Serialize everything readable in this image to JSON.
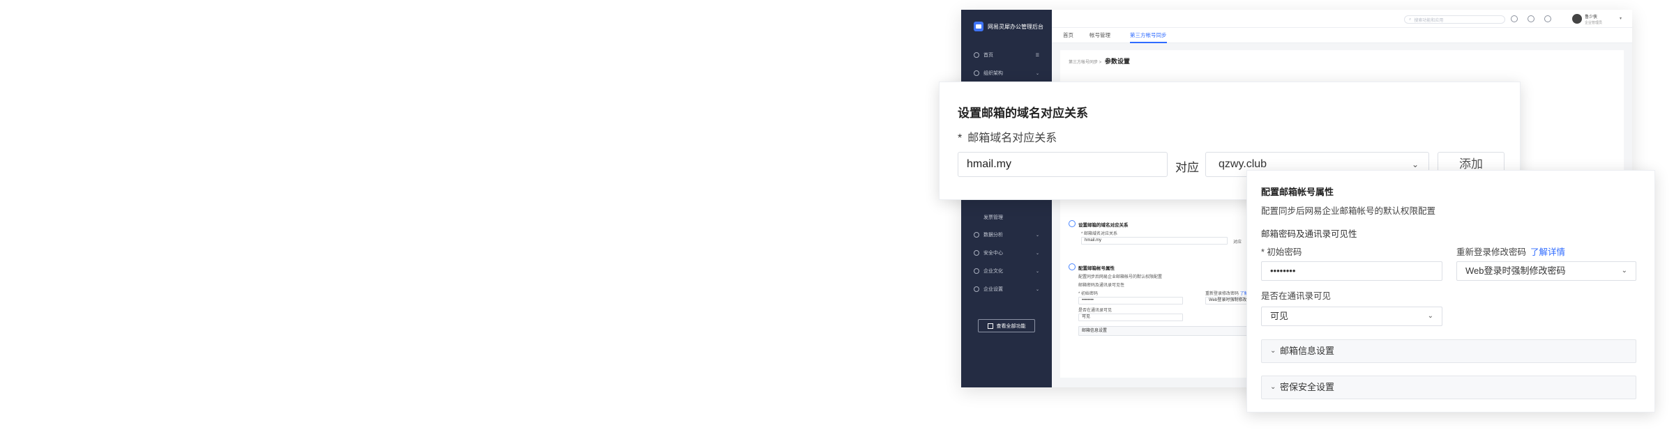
{
  "sidebar": {
    "app_title": "网易灵犀办公管理后台",
    "items": [
      {
        "label": "首页",
        "icon": "home-icon"
      },
      {
        "label": "组织架构",
        "icon": "org-icon"
      },
      {
        "label": "发票管理",
        "icon": ""
      },
      {
        "label": "数据分析",
        "icon": "chart-icon"
      },
      {
        "label": "安全中心",
        "icon": "shield-icon"
      },
      {
        "label": "企业文化",
        "icon": "culture-icon"
      },
      {
        "label": "企业设置",
        "icon": "gear-icon"
      }
    ],
    "show_all": "查看全部功能"
  },
  "topbar": {
    "search_placeholder": "搜索功能和应用",
    "user_name": "鲁少侠",
    "user_role": "企业管理员"
  },
  "tabs": [
    "首页",
    "帐号管理",
    "第三方帐号同步"
  ],
  "breadcrumb": {
    "parent": "第三方帐号同步",
    "current": "参数设置"
  },
  "mini": {
    "domain_title": "设置邮箱的域名对应关系",
    "domain_label": "* 邮箱域名对应关系",
    "domain_value": "hmail.my",
    "map_word": "对应",
    "attr_title": "配置邮箱帐号属性",
    "attr_desc": "配置同步后网易企业邮箱帐号的默认权限配置",
    "attr_sub": "邮箱密码及通讯录可见性",
    "pwd_label": "* 初始密码",
    "pwd_value": "••••••••",
    "relogin_label": "重新登录修改密码",
    "relogin_link": "了解",
    "relogin_value": "Web登录时强制修改",
    "visible_label": "是否在通讯录可见",
    "visible_value": "可见",
    "mailbox_coll": "邮箱信息设置"
  },
  "card1": {
    "title": "设置邮箱的域名对应关系",
    "star": "*",
    "label": "邮箱域名对应关系",
    "domain_value": "hmail.my",
    "map_word": "对应",
    "target_value": "qzwy.club",
    "add_button": "添加"
  },
  "card2": {
    "title": "配置邮箱帐号属性",
    "desc": "配置同步后网易企业邮箱帐号的默认权限配置",
    "sub": "邮箱密码及通讯录可见性",
    "pwd_label": "* 初始密码",
    "pwd_value": "••••••••",
    "relogin_label": "重新登录修改密码",
    "relogin_link": "了解详情",
    "relogin_value": "Web登录时强制修改密码",
    "visible_label": "是否在通讯录可见",
    "visible_value": "可见",
    "collapse1": "邮箱信息设置",
    "collapse2": "密保安全设置"
  },
  "colors": {
    "sidebar": "#242c43",
    "accent": "#2f6bff"
  }
}
